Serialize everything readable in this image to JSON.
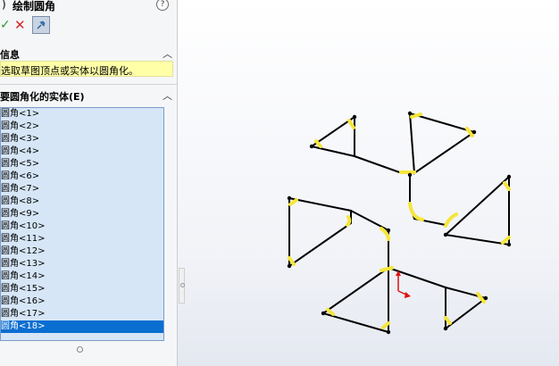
{
  "panel": {
    "title_prefix": ")",
    "title": "绘制圆角",
    "help_icon": "?",
    "ok_icon": "✓",
    "cancel_icon": "✕"
  },
  "info_section": {
    "header": "信息",
    "message": "选取草图顶点或实体以圆角化。"
  },
  "entities_section": {
    "header": "要圆角化的实体(E)",
    "items": [
      "圆角<1>",
      "圆角<2>",
      "圆角<3>",
      "圆角<4>",
      "圆角<5>",
      "圆角<6>",
      "圆角<7>",
      "圆角<8>",
      "圆角<9>",
      "圆角<10>",
      "圆角<11>",
      "圆角<12>",
      "圆角<13>",
      "圆角<14>",
      "圆角<15>",
      "圆角<16>",
      "圆角<17>",
      "圆角<18>"
    ],
    "selected_index": 17
  },
  "colors": {
    "selection": "#0a6ed1",
    "fillet_highlight": "#f5e63a",
    "sketch_line": "#000000",
    "axis_red": "#e01010"
  }
}
